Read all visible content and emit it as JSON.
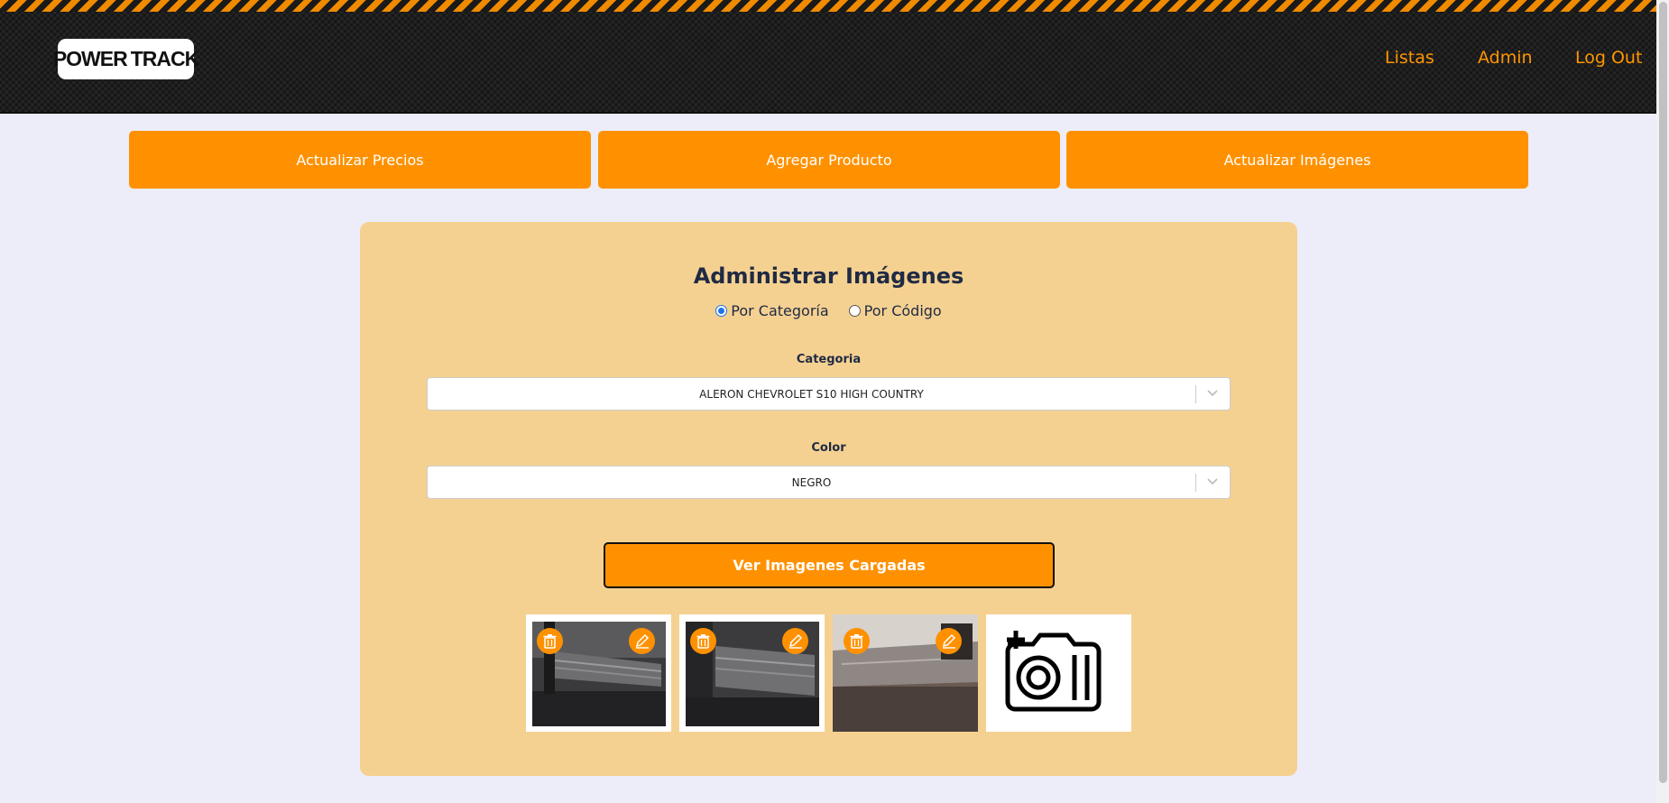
{
  "header": {
    "logo": {
      "left": "POWER",
      "right": "TRACK"
    },
    "nav": [
      "Listas",
      "Admin",
      "Log Out"
    ]
  },
  "actions": [
    "Actualizar Precios",
    "Agregar Producto",
    "Actualizar Imágenes"
  ],
  "panel": {
    "title": "Administrar Imágenes",
    "radios": [
      {
        "label": "Por Categoría",
        "checked": true
      },
      {
        "label": "Por Código",
        "checked": false
      }
    ],
    "category_label": "Categoria",
    "category_value": "ALERON CHEVROLET S10 HIGH COUNTRY",
    "color_label": "Color",
    "color_value": "NEGRO",
    "view_button": "Ver Imagenes Cargadas"
  },
  "colors": {
    "accent": "#ff9100",
    "panel": "#f5d191",
    "background": "#ecedf9"
  },
  "icons": [
    "trash-icon",
    "pencil-icon",
    "add-photo-icon",
    "chevron-down-icon"
  ]
}
